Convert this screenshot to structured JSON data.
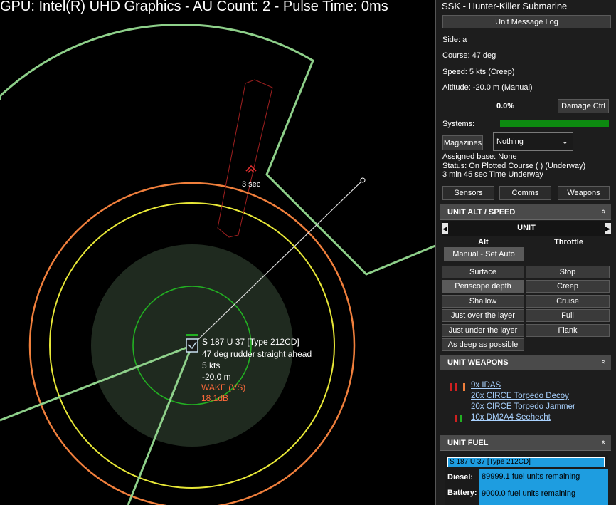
{
  "map": {
    "gpu_text": "GPU: Intel(R) UHD Graphics - AU Count: 2 - Pulse Time: 0ms",
    "contact_time": "3 sec",
    "unit_label": {
      "name": "S 187 U 37 [Type 212CD]",
      "course": "47 deg  rudder straight ahead",
      "speed": "5 kts",
      "depth": "-20.0 m",
      "wake": "WAKE (VS)",
      "db": "18.1dB"
    },
    "colors": {
      "range_outer": "#8ed08a",
      "range_orange": "#f07f3c",
      "range_yellow": "#e8e837",
      "range_inner": "#22b022",
      "red_zone": "#a02020"
    }
  },
  "panel": {
    "title": "SSK - Hunter-Killer Submarine",
    "message_log": "Unit Message Log",
    "side": "Side: a",
    "course": "Course: 47 deg",
    "speed": "Speed: 5 kts (Creep)",
    "altitude": "Altitude: -20.0 m (Manual)",
    "damage_pct": "0.0%",
    "damage_ctrl": "Damage Ctrl",
    "systems": "Systems:",
    "magazines": "Magazines",
    "magazine_select": "Nothing",
    "assigned_base": "Assigned base: None",
    "status": "Status: On Plotted Course ( )  (Underway)",
    "time_underway": "3 min 45 sec Time Underway",
    "tabs": {
      "sensors": "Sensors",
      "comms": "Comms",
      "weapons": "Weapons"
    },
    "alt_speed": {
      "header": "UNIT ALT / SPEED",
      "unit": "UNIT",
      "alt": "Alt",
      "throttle": "Throttle",
      "manual": "Manual - Set Auto",
      "alt_buttons": [
        "Surface",
        "Periscope depth",
        "Shallow",
        "Just over the layer",
        "Just under the layer",
        "As deep as possible"
      ],
      "throttle_buttons": [
        "Stop",
        "Creep",
        "Cruise",
        "Full",
        "Flank"
      ]
    },
    "weapons": {
      "header": "UNIT WEAPONS",
      "items": [
        "9x IDAS",
        "20x CIRCE Torpedo Decoy",
        "20x CIRCE Torpedo Jammer",
        "10x DM2A4 Seehecht"
      ]
    },
    "fuel": {
      "header": "UNIT FUEL",
      "unit_name": "S 187 U 37 [Type 212CD]",
      "diesel_label": "Diesel:",
      "diesel_value": "89999.1 fuel units remaining",
      "battery_label": "Battery:",
      "battery_value": "9000.0 fuel units remaining"
    },
    "chevron": "«"
  }
}
